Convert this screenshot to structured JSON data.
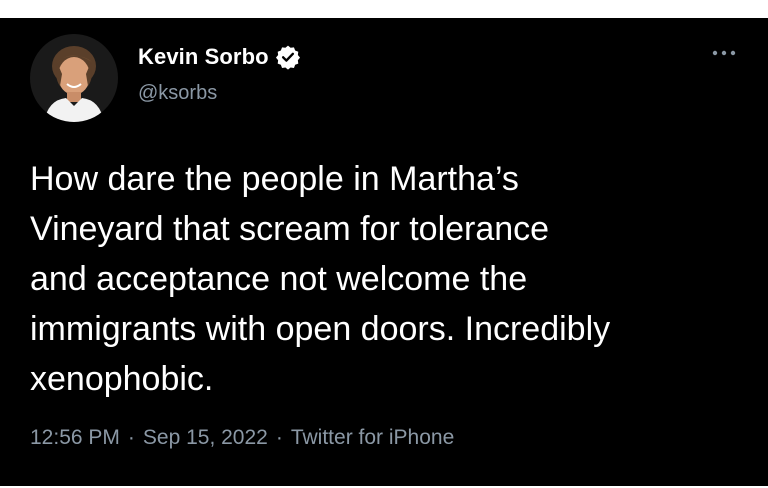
{
  "tweet": {
    "author": {
      "display_name": "Kevin Sorbo",
      "handle": "@ksorbs",
      "verified": true,
      "avatar_icon": "profile-photo"
    },
    "text": "How dare the people in Martha’s\nVineyard that scream for tolerance\nand acceptance not welcome the\nimmigrants with open doors. Incredibly\nxenophobic.",
    "meta": {
      "time": "12:56 PM",
      "separator": "·",
      "date": "Sep 15, 2022",
      "client": "Twitter for iPhone"
    }
  },
  "colors": {
    "background": "#000000",
    "primary_text": "#ffffff",
    "secondary_text": "#8b98a5",
    "verified_badge": "#ffffff"
  }
}
